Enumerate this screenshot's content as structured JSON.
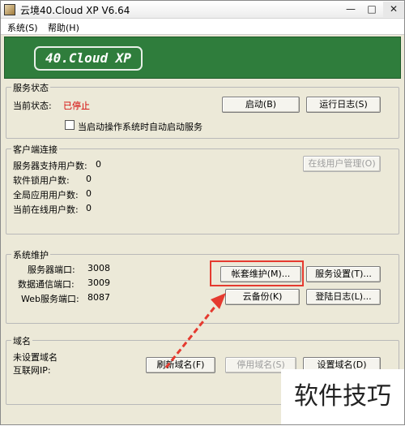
{
  "window": {
    "title": "云境40.Cloud XP V6.64",
    "minimize": "—",
    "maximize": "□",
    "close": "✕"
  },
  "menu": {
    "items": [
      "系统(S)",
      "帮助(H)"
    ]
  },
  "banner": {
    "logo": "40.Cloud XP"
  },
  "service_status": {
    "title": "服务状态",
    "current_label": "当前状态:",
    "current_value": "已停止",
    "start_button": "启动(B)",
    "log_button": "运行日志(S)",
    "autostart_label": "当启动操作系统时自动启动服务",
    "autostart_checked": false
  },
  "client_connections": {
    "title": "客户端连接",
    "rows": [
      {
        "label": "服务器支持用户数:",
        "value": "0"
      },
      {
        "label": "软件锁用户数:",
        "value": "0"
      },
      {
        "label": "全局应用用户数:",
        "value": "0"
      },
      {
        "label": "当前在线用户数:",
        "value": "0"
      }
    ],
    "online_users_button": "在线用户管理(O)"
  },
  "maintenance": {
    "title": "系统维护",
    "server_port_label": "服务器端口:",
    "server_port": "3008",
    "data_port_label": "数据通信端口:",
    "data_port": "3009",
    "web_port_label": "Web服务端口:",
    "web_port": "8087",
    "accounts_button": "帐套维护(M)...",
    "service_settings_button": "服务设置(T)...",
    "cloud_backup_button": "云备份(K)",
    "login_log_button": "登陆日志(L)..."
  },
  "domain": {
    "title": "域名",
    "unset_label": "未设置域名",
    "ip_label": "互联网IP:",
    "refresh_button": "刷新域名(F)",
    "disable_button": "停用域名(S)",
    "set_button": "设置域名(D)"
  },
  "watermark": "软件技巧",
  "colors": {
    "banner": "#2f7d3c",
    "highlight": "#e53a2f",
    "status_stopped": "#d40000"
  }
}
